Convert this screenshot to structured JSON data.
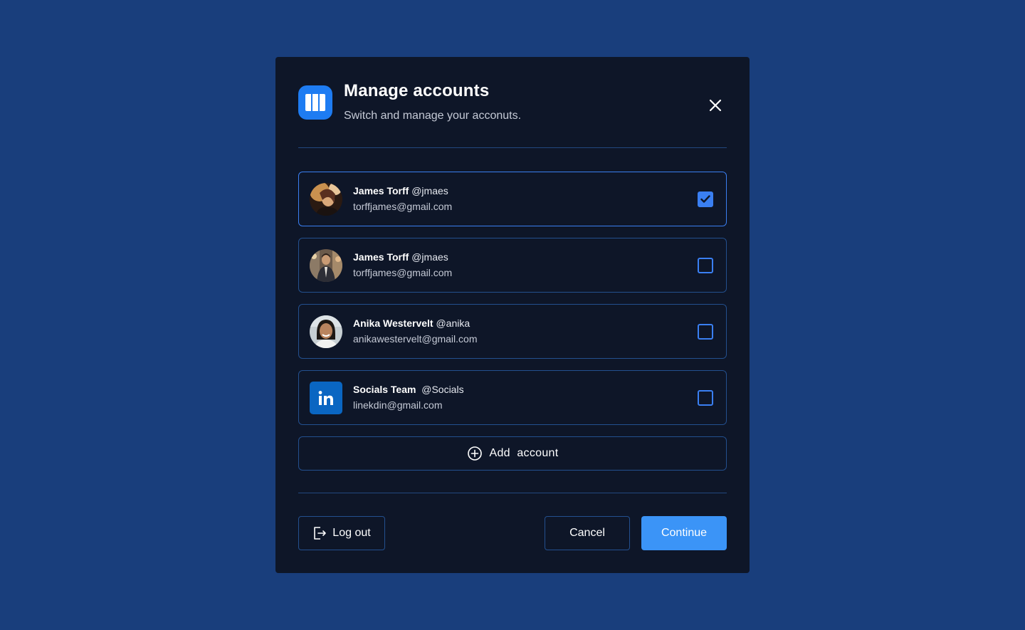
{
  "dialog": {
    "title": "Manage accounts",
    "subtitle": "Switch and manage your acconuts.",
    "app_icon": "columns-logo-icon",
    "close_icon": "close-icon"
  },
  "accounts": [
    {
      "name": "James Torff",
      "handle": "@jmaes",
      "email": "torffjames@gmail.com",
      "selected": true,
      "avatar": "photo-avatar"
    },
    {
      "name": "James Torff",
      "handle": "@jmaes",
      "email": "torffjames@gmail.com",
      "selected": false,
      "avatar": "photo-avatar"
    },
    {
      "name": "Anika Westervelt",
      "handle": "@anika",
      "email": "anikawestervelt@gmail.com",
      "selected": false,
      "avatar": "photo-avatar"
    },
    {
      "name": "Socials Team",
      "handle": "@Socials",
      "email": "linekdin@gmail.com",
      "selected": false,
      "avatar": "linkedin-logo-icon"
    }
  ],
  "add_account": {
    "label": "Add  account",
    "icon": "plus-circle-icon"
  },
  "footer": {
    "logout_label": "Log out",
    "logout_icon": "logout-icon",
    "cancel_label": "Cancel",
    "continue_label": "Continue"
  },
  "colors": {
    "background": "#193e7c",
    "modal": "#0e1628",
    "accent": "#3a7ff2",
    "continue": "#3b94f7",
    "border": "#23508f"
  }
}
